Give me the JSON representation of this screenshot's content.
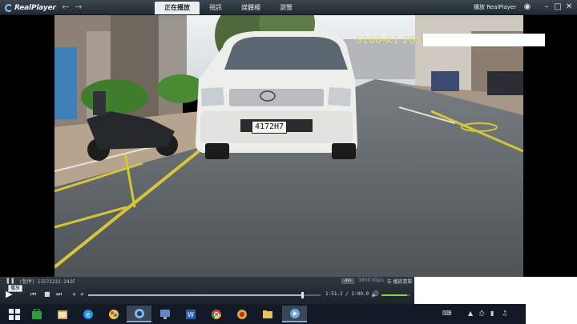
{
  "app": {
    "logo_text": "RealPlayer",
    "brand_text": "播放 RealPlayer",
    "tabs": [
      {
        "label": "正在播放",
        "active": true
      },
      {
        "label": "視訊",
        "active": false
      },
      {
        "label": "媒體櫃",
        "active": false
      },
      {
        "label": "瀏覽",
        "active": false
      }
    ],
    "nav": {
      "back_icon": "back-arrow-icon",
      "forward_icon": "forward-arrow-icon"
    },
    "window_buttons": [
      "eye-icon",
      "minimize-icon",
      "restore-icon",
      "close-icon"
    ]
  },
  "video": {
    "overlay_text": "S100-K1 2017",
    "license_plate": "4172H7"
  },
  "controls": {
    "now_playing": "(暫停) 115?2222-242F",
    "badge": "AVI",
    "bitrate": "3800 Kbps",
    "record_label": "播放清單",
    "tooltip": "播放",
    "time": "1:51.2 / 2:00.0",
    "progress": 0.92,
    "volume": 0.9,
    "accent_color": "#8bd24a"
  },
  "taskbar": {
    "apps": [
      "windows-start-icon",
      "store-icon",
      "explorer-icon",
      "ie-icon",
      "paint-icon",
      "realplayer-icon",
      "monitor-icon",
      "word-icon",
      "chrome-icon",
      "game-icon",
      "folder-icon",
      "realplayer-active-icon"
    ],
    "tray": [
      "keyboard-icon",
      "network-icon",
      "printer-icon",
      "battery-icon",
      "volume-icon"
    ]
  }
}
